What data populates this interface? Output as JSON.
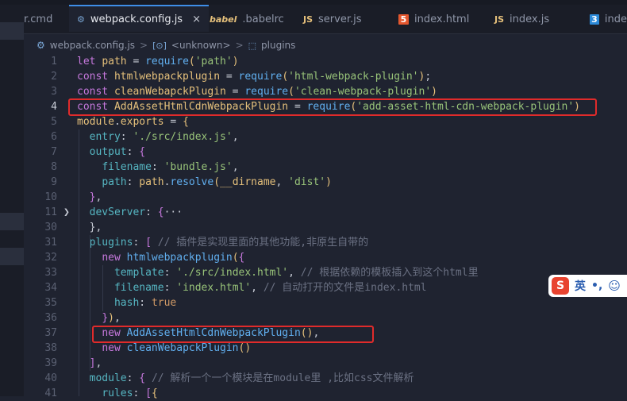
{
  "tabs": [
    {
      "label": "r.cmd",
      "icon": "file-icon"
    },
    {
      "label": "webpack.config.js",
      "icon": "gear-icon",
      "close": "×"
    },
    {
      "label": ".babelrc",
      "icon": "babel-icon",
      "glyph": "babel"
    },
    {
      "label": "server.js",
      "icon": "js-icon",
      "glyph": "JS"
    },
    {
      "label": "index.html",
      "icon": "html5-icon",
      "glyph": "5"
    },
    {
      "label": "index.js",
      "icon": "js-icon",
      "glyph": "JS"
    },
    {
      "label": "inde",
      "icon": "css3-icon",
      "glyph": "3"
    }
  ],
  "breadcrumb": {
    "file": "webpack.config.js",
    "sep": ">",
    "symbol_glyph": "[⊙]",
    "unknown": "<unknown>",
    "plugins": "plugins"
  },
  "lines": [
    {
      "n": "1",
      "t": [
        [
          "k",
          "let"
        ],
        [
          "p",
          " "
        ],
        [
          "v",
          "path"
        ],
        [
          "p",
          " = "
        ],
        [
          "f",
          "require"
        ],
        [
          "br",
          "("
        ],
        [
          "s",
          "'path'"
        ],
        [
          "br",
          ")"
        ]
      ]
    },
    {
      "n": "2",
      "t": [
        [
          "k",
          "const"
        ],
        [
          "p",
          " "
        ],
        [
          "v",
          "htmlwebpackplugin"
        ],
        [
          "p",
          " = "
        ],
        [
          "f",
          "require"
        ],
        [
          "br",
          "("
        ],
        [
          "s",
          "'html-webpack-plugin'"
        ],
        [
          "br",
          ")"
        ],
        [
          "p",
          ";"
        ]
      ]
    },
    {
      "n": "3",
      "t": [
        [
          "k",
          "const"
        ],
        [
          "p",
          " "
        ],
        [
          "v",
          "cleanWebapckPlugin"
        ],
        [
          "p",
          " = "
        ],
        [
          "f",
          "require"
        ],
        [
          "br",
          "("
        ],
        [
          "s",
          "'clean-webpack-plugin'"
        ],
        [
          "br",
          ")"
        ]
      ]
    },
    {
      "n": "4",
      "t": [
        [
          "k",
          "const"
        ],
        [
          "p",
          " "
        ],
        [
          "v",
          "AddAssetHtmlCdnWebpackPlugin"
        ],
        [
          "p",
          " = "
        ],
        [
          "f",
          "require"
        ],
        [
          "br",
          "("
        ],
        [
          "s",
          "'add-asset-html-cdn-webpack-plugin'"
        ],
        [
          "br",
          ")"
        ]
      ]
    },
    {
      "n": "5",
      "t": [
        [
          "v",
          "module"
        ],
        [
          "p",
          "."
        ],
        [
          "v",
          "exports"
        ],
        [
          "p",
          " = "
        ],
        [
          "br",
          "{"
        ]
      ]
    },
    {
      "n": "6",
      "t": [
        [
          "p",
          "  "
        ],
        [
          "prop",
          "entry"
        ],
        [
          "p",
          ": "
        ],
        [
          "s",
          "'./src/index.js'"
        ],
        [
          "p",
          ","
        ]
      ]
    },
    {
      "n": "7",
      "t": [
        [
          "p",
          "  "
        ],
        [
          "prop",
          "output"
        ],
        [
          "p",
          ": "
        ],
        [
          "k",
          "{"
        ]
      ]
    },
    {
      "n": "8",
      "t": [
        [
          "p",
          "    "
        ],
        [
          "prop",
          "filename"
        ],
        [
          "p",
          ": "
        ],
        [
          "s",
          "'bundle.js'"
        ],
        [
          "p",
          ","
        ]
      ]
    },
    {
      "n": "9",
      "t": [
        [
          "p",
          "    "
        ],
        [
          "prop",
          "path"
        ],
        [
          "p",
          ": "
        ],
        [
          "v",
          "path"
        ],
        [
          "p",
          "."
        ],
        [
          "f",
          "resolve"
        ],
        [
          "br",
          "("
        ],
        [
          "v",
          "__dirname"
        ],
        [
          "p",
          ", "
        ],
        [
          "s",
          "'dist'"
        ],
        [
          "br",
          ")"
        ]
      ]
    },
    {
      "n": "10",
      "t": [
        [
          "p",
          "  "
        ],
        [
          "k",
          "}"
        ],
        [
          "p",
          ","
        ]
      ]
    },
    {
      "n": "11",
      "t": [
        [
          "p",
          "  "
        ],
        [
          "prop",
          "devServer"
        ],
        [
          "p",
          ": "
        ],
        [
          "k",
          "{"
        ],
        [
          "p",
          "···"
        ]
      ]
    },
    {
      "n": "30",
      "t": [
        [
          "p",
          "  },"
        ]
      ]
    },
    {
      "n": "31",
      "t": [
        [
          "p",
          "  "
        ],
        [
          "prop",
          "plugins"
        ],
        [
          "p",
          ": "
        ],
        [
          "k",
          "["
        ],
        [
          "p",
          " "
        ],
        [
          "c",
          "// 插件是实现里面的其他功能,非原生自带的"
        ]
      ]
    },
    {
      "n": "32",
      "t": [
        [
          "p",
          "    "
        ],
        [
          "k",
          "new"
        ],
        [
          "p",
          " "
        ],
        [
          "f",
          "htmlwebpackplugin"
        ],
        [
          "br",
          "("
        ],
        [
          "k",
          "{"
        ]
      ]
    },
    {
      "n": "33",
      "t": [
        [
          "p",
          "      "
        ],
        [
          "prop",
          "template"
        ],
        [
          "p",
          ": "
        ],
        [
          "s",
          "'./src/index.html'"
        ],
        [
          "p",
          ", "
        ],
        [
          "c",
          "// 根据依赖的模板插入到这个html里"
        ]
      ]
    },
    {
      "n": "34",
      "t": [
        [
          "p",
          "      "
        ],
        [
          "prop",
          "filename"
        ],
        [
          "p",
          ": "
        ],
        [
          "s",
          "'index.html'"
        ],
        [
          "p",
          ", "
        ],
        [
          "c",
          "// 自动打开的文件是index.html"
        ]
      ]
    },
    {
      "n": "35",
      "t": [
        [
          "p",
          "      "
        ],
        [
          "prop",
          "hash"
        ],
        [
          "p",
          ": "
        ],
        [
          "b",
          "true"
        ]
      ]
    },
    {
      "n": "36",
      "t": [
        [
          "p",
          "    "
        ],
        [
          "k",
          "}"
        ],
        [
          "br",
          ")"
        ],
        [
          "p",
          ","
        ]
      ]
    },
    {
      "n": "37",
      "t": [
        [
          "p",
          "    "
        ],
        [
          "k",
          "new"
        ],
        [
          "p",
          " "
        ],
        [
          "f",
          "AddAssetHtmlCdnWebpackPlugin"
        ],
        [
          "br",
          "()"
        ],
        [
          "p",
          ","
        ]
      ]
    },
    {
      "n": "38",
      "t": [
        [
          "p",
          "    "
        ],
        [
          "k",
          "new"
        ],
        [
          "p",
          " "
        ],
        [
          "f",
          "cleanWebapckPlugin"
        ],
        [
          "br",
          "()"
        ]
      ]
    },
    {
      "n": "39",
      "t": [
        [
          "p",
          "  "
        ],
        [
          "k",
          "]"
        ],
        [
          "p",
          ","
        ]
      ]
    },
    {
      "n": "40",
      "t": [
        [
          "p",
          "  "
        ],
        [
          "prop",
          "module"
        ],
        [
          "p",
          ": "
        ],
        [
          "k",
          "{"
        ],
        [
          "p",
          " "
        ],
        [
          "c",
          "// 解析一个一个模块是在module里 ,比如css文件解析"
        ]
      ]
    },
    {
      "n": "41",
      "t": [
        [
          "p",
          "    "
        ],
        [
          "prop",
          "rules"
        ],
        [
          "p",
          ": "
        ],
        [
          "k",
          "["
        ],
        [
          "br",
          "{"
        ]
      ]
    }
  ],
  "ime": {
    "logo": "S",
    "lang": "英",
    "punct": "•,",
    "emoji": "☺"
  }
}
